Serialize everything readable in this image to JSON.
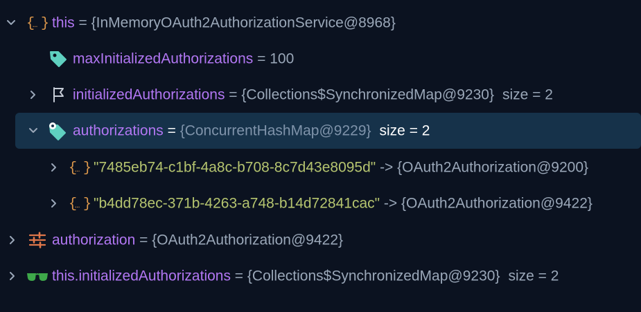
{
  "tree": {
    "rows": [
      {
        "name": "this",
        "equals": " = ",
        "value": "{InMemoryOAuth2AuthorizationService@8968}",
        "icon": "object-braces-icon",
        "expanded": true
      },
      {
        "name": "maxInitializedAuthorizations",
        "equals": " = ",
        "value": "100",
        "icon": "tag-icon"
      },
      {
        "name": "initializedAuthorizations",
        "equals": " = ",
        "value": "{Collections$SynchronizedMap@9230}",
        "size": "size = 2",
        "icon": "flag-icon",
        "expanded": false
      },
      {
        "name": "authorizations",
        "equals": " = ",
        "value": "{ConcurrentHashMap@9229}",
        "size": "size = 2",
        "icon": "tag-gear-icon",
        "expanded": true,
        "selected": true
      },
      {
        "key": "\"7485eb74-c1bf-4a8c-b708-8c7d43e8095d\"",
        "arrow": " -> ",
        "value": "{OAuth2Authorization@9200}",
        "icon": "object-braces-icon",
        "expanded": false
      },
      {
        "key": "\"b4dd78ec-371b-4263-a748-b14d72841cac\"",
        "arrow": " -> ",
        "value": "{OAuth2Authorization@9422}",
        "icon": "object-braces-icon",
        "expanded": false
      },
      {
        "name": "authorization",
        "equals": " = ",
        "value": "{OAuth2Authorization@9422}",
        "icon": "sliders-icon",
        "expanded": false
      },
      {
        "name": "this.initializedAuthorizations",
        "equals": " = ",
        "value": "{Collections$SynchronizedMap@9230}",
        "size": "size = 2",
        "icon": "glasses-icon",
        "expanded": false
      }
    ]
  },
  "colors": {
    "background": "#0b1220",
    "selection": "#16324a",
    "name": "#b277f3",
    "text": "#9aa7b8",
    "string": "#b5c46f",
    "braces": "#e09a4c",
    "tag": "#5fd0c0",
    "glasses": "#3ea84a"
  }
}
